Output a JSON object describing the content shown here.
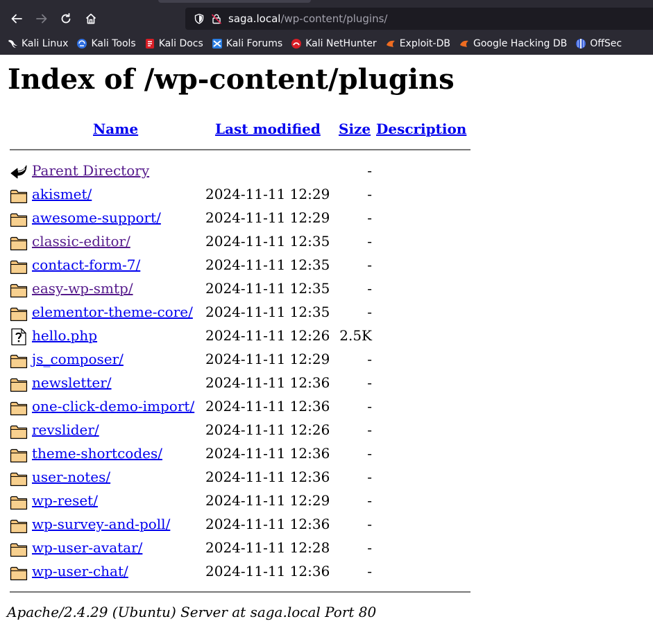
{
  "browser": {
    "url_host": "saga.local",
    "url_path": "/wp-content/plugins/",
    "bookmarks": [
      {
        "label": "Kali Linux",
        "icon": "kali-dragon-icon"
      },
      {
        "label": "Kali Tools",
        "icon": "kali-tools-icon"
      },
      {
        "label": "Kali Docs",
        "icon": "kali-docs-icon"
      },
      {
        "label": "Kali Forums",
        "icon": "kali-forums-icon"
      },
      {
        "label": "Kali NetHunter",
        "icon": "kali-nethunter-icon"
      },
      {
        "label": "Exploit-DB",
        "icon": "exploit-db-icon"
      },
      {
        "label": "Google Hacking DB",
        "icon": "google-hacking-db-icon"
      },
      {
        "label": "OffSec",
        "icon": "offsec-icon"
      }
    ]
  },
  "page": {
    "title": "Index of /wp-content/plugins",
    "columns": {
      "name": "Name",
      "modified": "Last modified",
      "size": "Size",
      "description": "Description"
    },
    "parent": {
      "label": "Parent Directory",
      "size": "-",
      "icon": "back-arrow-icon"
    },
    "entries": [
      {
        "name": "akismet/",
        "modified": "2024-11-11 12:29",
        "size": "-",
        "type": "folder",
        "visited": false
      },
      {
        "name": "awesome-support/",
        "modified": "2024-11-11 12:29",
        "size": "-",
        "type": "folder",
        "visited": false
      },
      {
        "name": "classic-editor/",
        "modified": "2024-11-11 12:35",
        "size": "-",
        "type": "folder",
        "visited": true
      },
      {
        "name": "contact-form-7/",
        "modified": "2024-11-11 12:35",
        "size": "-",
        "type": "folder",
        "visited": false
      },
      {
        "name": "easy-wp-smtp/",
        "modified": "2024-11-11 12:35",
        "size": "-",
        "type": "folder",
        "visited": true
      },
      {
        "name": "elementor-theme-core/",
        "modified": "2024-11-11 12:35",
        "size": "-",
        "type": "folder",
        "visited": false
      },
      {
        "name": "hello.php",
        "modified": "2024-11-11 12:26",
        "size": "2.5K",
        "type": "file",
        "visited": false
      },
      {
        "name": "js_composer/",
        "modified": "2024-11-11 12:29",
        "size": "-",
        "type": "folder",
        "visited": false
      },
      {
        "name": "newsletter/",
        "modified": "2024-11-11 12:36",
        "size": "-",
        "type": "folder",
        "visited": false
      },
      {
        "name": "one-click-demo-import/",
        "modified": "2024-11-11 12:36",
        "size": "-",
        "type": "folder",
        "visited": false
      },
      {
        "name": "revslider/",
        "modified": "2024-11-11 12:26",
        "size": "-",
        "type": "folder",
        "visited": false
      },
      {
        "name": "theme-shortcodes/",
        "modified": "2024-11-11 12:36",
        "size": "-",
        "type": "folder",
        "visited": false
      },
      {
        "name": "user-notes/",
        "modified": "2024-11-11 12:36",
        "size": "-",
        "type": "folder",
        "visited": false
      },
      {
        "name": "wp-reset/",
        "modified": "2024-11-11 12:29",
        "size": "-",
        "type": "folder",
        "visited": false
      },
      {
        "name": "wp-survey-and-poll/",
        "modified": "2024-11-11 12:36",
        "size": "-",
        "type": "folder",
        "visited": false
      },
      {
        "name": "wp-user-avatar/",
        "modified": "2024-11-11 12:28",
        "size": "-",
        "type": "folder",
        "visited": false
      },
      {
        "name": "wp-user-chat/",
        "modified": "2024-11-11 12:36",
        "size": "-",
        "type": "folder",
        "visited": false
      }
    ],
    "footer": "Apache/2.4.29 (Ubuntu) Server at saga.local Port 80"
  },
  "colors": {
    "link": "#0000ee",
    "visited_link": "#551a8b",
    "toolbar": "#2b2a33",
    "url_field": "#1c1b22"
  }
}
